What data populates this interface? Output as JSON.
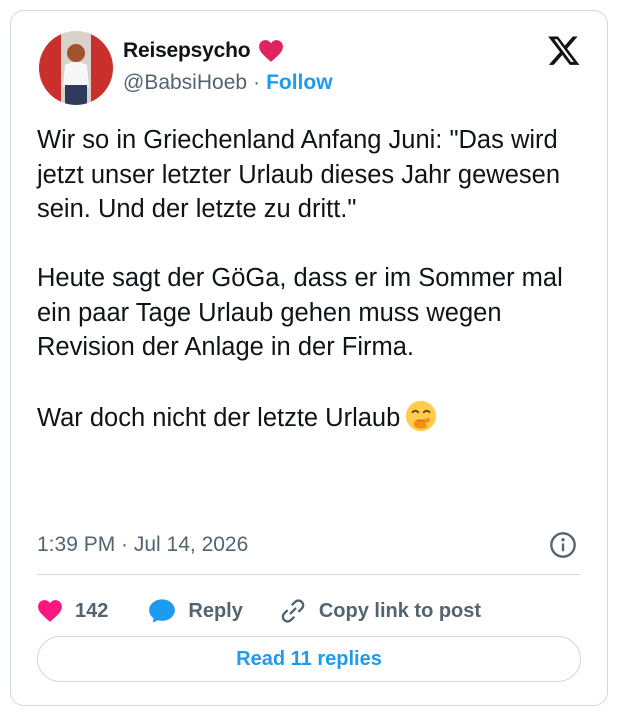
{
  "author": {
    "display_name": "Reisepsycho",
    "handle": "@BabsiHoeb",
    "separator": "·",
    "follow_label": "Follow"
  },
  "tweet": {
    "text": "Wir so in Griechenland Anfang Juni: \"Das wird jetzt unser letzter Urlaub dieses Jahr gewesen sein. Und der letzte zu dritt.\"\n\nHeute sagt der GöGa, dass er im Sommer mal ein paar Tage Urlaub gehen muss wegen Revision der Anlage in der Firma.\n\nWar doch nicht der letzte Urlaub",
    "trailing_emoji": "face-with-hand-over-mouth-emoji",
    "timestamp": "1:39 PM · Jul 14, 2026"
  },
  "actions": {
    "like_count": "142",
    "reply_label": "Reply",
    "copy_label": "Copy link to post"
  },
  "read_replies_label": "Read 11 replies",
  "icons": {
    "brand": "x-logo-icon",
    "badge": "red-heart-icon",
    "like": "heart-icon",
    "reply": "speech-bubble-icon",
    "copy": "link-icon",
    "info": "info-icon"
  },
  "colors": {
    "accent": "#1d9bf0",
    "like": "#f91880",
    "badge_heart": "#e0245e",
    "muted": "#536471",
    "text": "#0f1419",
    "border": "#cfd9de"
  }
}
